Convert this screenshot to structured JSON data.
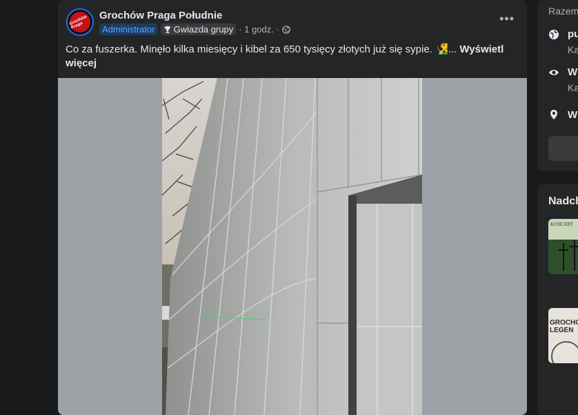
{
  "post": {
    "group_name": "Grochów Praga Południe",
    "avatar_text": "Grochów Praga",
    "badge_admin": "Administrator",
    "badge_star": "Gwiazda grupy",
    "time": "· 1 godz. ·",
    "text": "Co za fuszerka. Minęło kilka miesięcy i kibel za 650 tysięcy złotych już się sypie. 🧏‍♂️...",
    "see_more": "Wyświetl więcej",
    "more_icon": "more-horizontal-icon"
  },
  "sidebar": {
    "top_text": "Razem",
    "rows": [
      {
        "title": "pu",
        "sub": "Ka",
        "icon": "globe-icon"
      },
      {
        "title": "W",
        "sub": "Ka",
        "icon": "eye-icon"
      },
      {
        "title": "W",
        "sub": "",
        "icon": "location-pin-icon"
      }
    ],
    "upcoming_title": "Nadch",
    "thumb1_text": "KONCERT",
    "thumb2_text": "GROCHÓ LEGEN"
  },
  "colors": {
    "background": "#18191a",
    "card": "#242526",
    "accent_blue": "#5aa7ff",
    "text_primary": "#e4e6eb",
    "text_secondary": "#b0b3b8"
  }
}
